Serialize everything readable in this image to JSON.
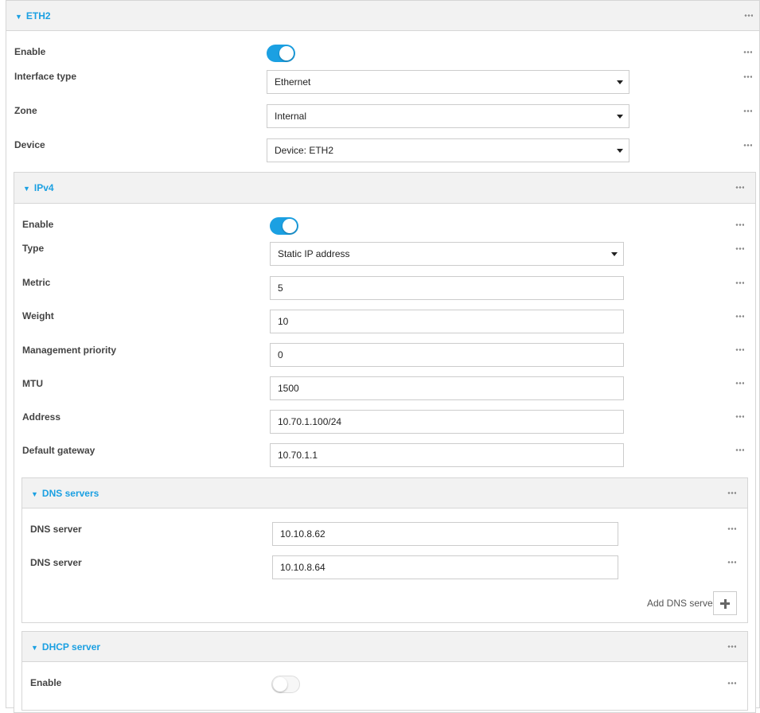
{
  "eth2": {
    "title": "ETH2",
    "enable_label": "Enable",
    "enable_state": "on",
    "interface_type_label": "Interface type",
    "interface_type_value": "Ethernet",
    "zone_label": "Zone",
    "zone_value": "Internal",
    "device_label": "Device",
    "device_value": "Device: ETH2"
  },
  "ipv4": {
    "title": "IPv4",
    "enable_label": "Enable",
    "enable_state": "on",
    "type_label": "Type",
    "type_value": "Static IP address",
    "metric_label": "Metric",
    "metric_value": "5",
    "weight_label": "Weight",
    "weight_value": "10",
    "mgmt_priority_label": "Management priority",
    "mgmt_priority_value": "0",
    "mtu_label": "MTU",
    "mtu_value": "1500",
    "address_label": "Address",
    "address_value": "10.70.1.100/24",
    "gateway_label": "Default gateway",
    "gateway_value": "10.70.1.1"
  },
  "dns": {
    "title": "DNS servers",
    "servers": [
      {
        "label": "DNS server",
        "value": "10.10.8.62"
      },
      {
        "label": "DNS server",
        "value": "10.10.8.64"
      }
    ],
    "add_label": "Add DNS server"
  },
  "dhcp": {
    "title": "DHCP server",
    "enable_label": "Enable",
    "enable_state": "off"
  },
  "colors": {
    "accent": "#1ba0e2",
    "header_bg": "#f2f2f2",
    "border": "#d6d6d6"
  },
  "icons": {
    "expand": "triangle-down-icon",
    "more": "ellipsis-icon",
    "dropdown": "caret-down-icon",
    "add": "plus-icon"
  }
}
